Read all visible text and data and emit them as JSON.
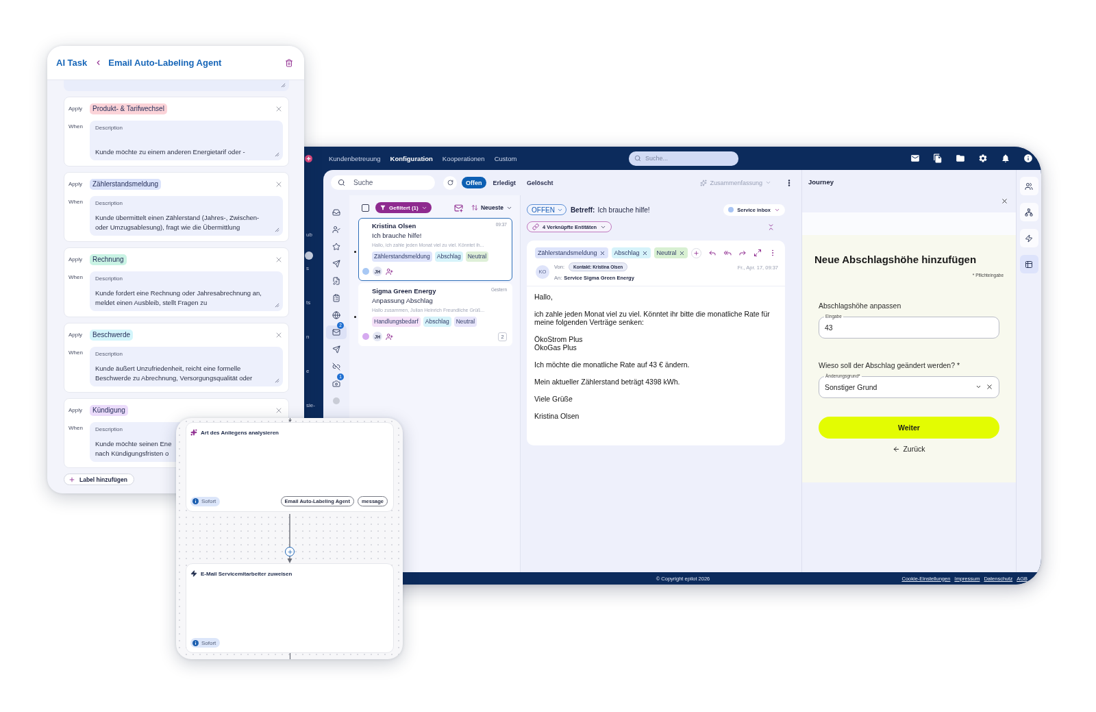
{
  "ai_task_panel": {
    "breadcrumb": "AI Task",
    "title": "Email Auto-Labeling Agent",
    "labels": [
      {
        "apply_label": "Apply",
        "tag": "Produkt- & Tarifwechsel",
        "color": "#fbd3d8",
        "when_label": "When",
        "field_label": "Description",
        "description": "Kunde möchte zu einem anderen Energietarif oder -"
      },
      {
        "apply_label": "Apply",
        "tag": "Zählerstandsmeldung",
        "color": "#dbe3fb",
        "when_label": "When",
        "field_label": "Description",
        "description": "Kunde übermittelt einen Zählerstand (Jahres-, Zwischen-\noder Umzugsablesung), fragt wie die Übermittlung"
      },
      {
        "apply_label": "Apply",
        "tag": "Rechnung",
        "color": "#c9f3e4",
        "when_label": "When",
        "field_label": "Description",
        "description": "Kunde fordert eine Rechnung oder Jahresabrechnung an,\nmeldet einen Ausbleib, stellt Fragen zu"
      },
      {
        "apply_label": "Apply",
        "tag": "Beschwerde",
        "color": "#d3f5fb",
        "when_label": "When",
        "field_label": "Description",
        "description": "Kunde äußert Unzufriedenheit, reicht eine formelle\nBeschwerde zu Abrechnung, Versorgungsqualität oder"
      },
      {
        "apply_label": "Apply",
        "tag": "Kündigung",
        "color": "#ebdbfb",
        "when_label": "When",
        "field_label": "Description",
        "description": "Kunde möchte seinen Ene\nnach Kündigungsfristen o"
      }
    ],
    "add_button": "Label hinzufügen"
  },
  "main_app": {
    "nav_fragments": [
      "ub",
      "s",
      "ts",
      "n",
      "e",
      "sie-"
    ],
    "top_tabs": [
      {
        "label": "Kundenbetreuung",
        "selected": false
      },
      {
        "label": "Konfiguration",
        "selected": true
      },
      {
        "label": "Kooperationen",
        "selected": false
      },
      {
        "label": "Custom",
        "selected": false
      }
    ],
    "global_search": {
      "placeholder": "Suche..."
    },
    "inbox_toolbar": {
      "search": {
        "placeholder": "Suche"
      },
      "status_tabs": [
        {
          "label": "Offen",
          "selected": true
        },
        {
          "label": "Erledigt",
          "selected": false
        },
        {
          "label": "Gelöscht",
          "selected": false
        }
      ],
      "summary": "Zusammenfassung"
    },
    "nav_icons": [
      {
        "selected": false
      },
      {
        "selected": false
      },
      {
        "selected": false
      },
      {
        "selected": false
      },
      {
        "selected": false
      },
      {
        "selected": false
      },
      {
        "selected": false
      },
      {
        "selected": true,
        "badge": "2"
      },
      {
        "selected": false
      },
      {
        "selected": false
      },
      {
        "selected": false,
        "badge": "1"
      },
      {
        "selected": false
      }
    ],
    "list_header": {
      "checked": false,
      "filter": "Gefiltert (1)",
      "sort": "Neueste"
    },
    "conversations": [
      {
        "sender": "Kristina Olsen",
        "time": "09:37",
        "subject": "Ich brauche hilfe!",
        "preview": "Hallo, ich zahle jeden Monat viel zu viel. Könntet ih...",
        "tags": [
          {
            "label": "Zählerstandsmeldung",
            "color": "#dee4fb"
          },
          {
            "label": "Abschlag",
            "color": "#d6f3fa"
          },
          {
            "label": "Neutral",
            "color": "#deefd7"
          }
        ],
        "color": "#a8c8f4",
        "assignee": "JH",
        "unread": true,
        "selected": true
      },
      {
        "sender": "Sigma Green Energy",
        "time": "Gestern",
        "subject": "Anpassung Abschlag",
        "preview": "Hallo zusammen, Julian Heinrich Freundliche Grüß...",
        "tags": [
          {
            "label": "Handlungsbedarf",
            "color": "#f5e1f8"
          },
          {
            "label": "Abschlag",
            "color": "#d6f3fa"
          },
          {
            "label": "Neutral",
            "color": "#e7e5fa"
          }
        ],
        "color": "#d6aaf0",
        "assignee": "JH",
        "count": "2",
        "unread": true,
        "selected": false
      }
    ],
    "email": {
      "status": "OFFEN",
      "subject_label": "Betreff:",
      "subject": "Ich brauche hilfe!",
      "inbox": "Service inbox",
      "linked": "4 Verknüpfte Entitäten",
      "tags": [
        {
          "label": "Zählerstandsmeldung",
          "color": "#dee4fb"
        },
        {
          "label": "Abschlag",
          "color": "#d6f3fa"
        },
        {
          "label": "Neutral",
          "color": "#d8f0d2"
        }
      ],
      "avatar": "KO",
      "from_label": "Von:",
      "from": "Kontakt: Kristina Olsen",
      "to_label": "An:",
      "to": "Service Sigma Green Energy",
      "date": "Fr., Apr. 17, 09:37",
      "body": [
        "Hallo,",
        "ich zahle jeden Monat viel zu viel. Könntet ihr bitte die monatliche Rate für\nmeine folgenden Verträge senken:",
        "ÖkoStrom Plus\nÖkoGas Plus",
        "Ich möchte die monatliche Rate auf 43 € ändern.",
        "Mein aktueller Zählerstand beträgt 4398 kWh.",
        "Viele Grüße",
        "Kristina Olsen"
      ]
    },
    "journey": {
      "title": "Journey",
      "heading": "Neue Abschlagshöhe hinzufügen",
      "required_note": "* Pflichteingabe",
      "amount": {
        "label": "Abschlagshöhe anpassen",
        "field_label": "Eingabe",
        "value": "43"
      },
      "reason": {
        "label": "Wieso soll der Abschlag geändert werden? *",
        "field_label": "Änderungsgrund*",
        "value": "Sonstiger Grund"
      },
      "next_button": "Weiter",
      "back_button": "Zurück"
    },
    "rail_icons": [
      {
        "selected": false
      },
      {
        "selected": false
      },
      {
        "selected": false
      },
      {
        "selected": true
      }
    ],
    "footer": {
      "copyright": "© Copyright epilot 2026",
      "links": [
        "Cookie-Einstellungen",
        "Impressum",
        "Datenschutz",
        "AGB"
      ]
    }
  },
  "flow_panel": {
    "steps": [
      {
        "kind": "ai",
        "title": "Art des Anliegens analysieren",
        "trigger": "Sofort",
        "chips": [
          "Email Auto-Labeling Agent",
          "message"
        ]
      },
      {
        "kind": "action",
        "title": "E-Mail Servicemitarbeiter zuweisen",
        "trigger": "Sofort"
      }
    ]
  }
}
